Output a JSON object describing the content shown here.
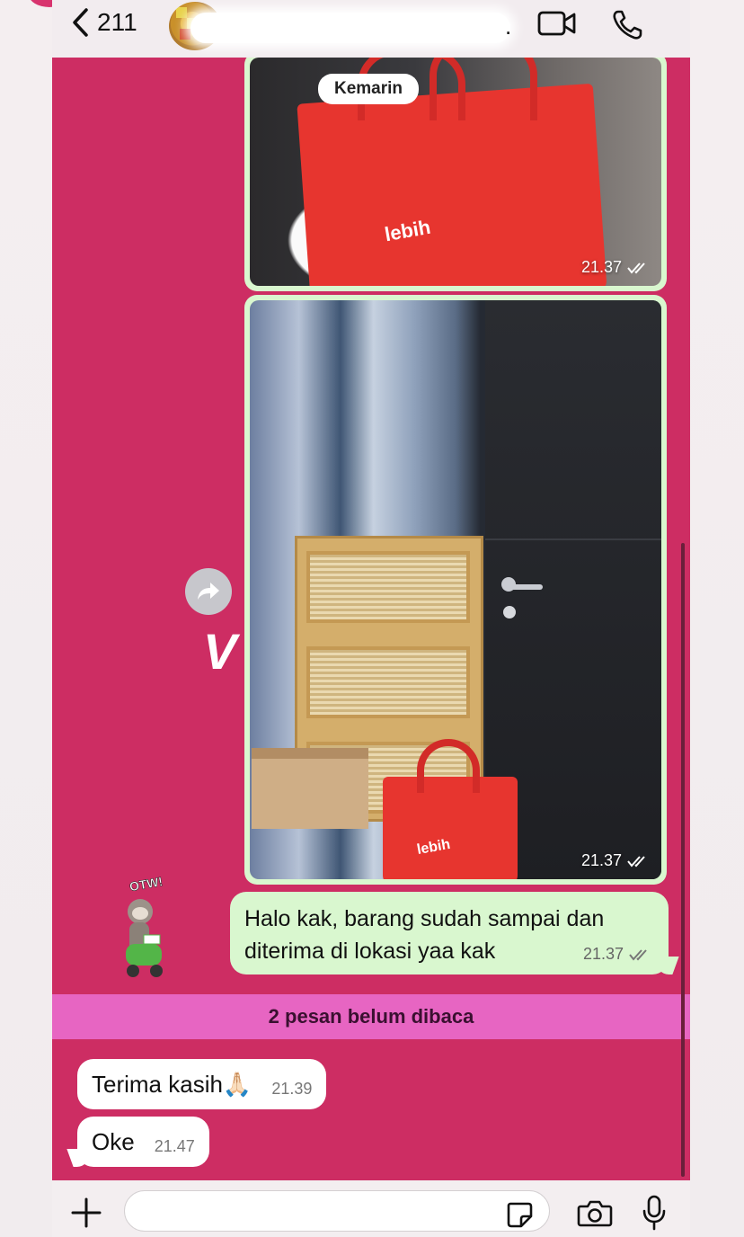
{
  "header": {
    "back_count": "211",
    "name_suffix": "."
  },
  "chat": {
    "date_divider": "Kemarin",
    "images": [
      {
        "time": "21.37",
        "status": "read"
      },
      {
        "time": "21.37",
        "status": "read"
      }
    ],
    "side_mark": "V",
    "sticker_text": "OTW!",
    "outgoing_message": {
      "text": "Halo kak, barang sudah sampai dan diterima di lokasi yaa kak",
      "time": "21.37",
      "status": "read"
    },
    "unread_banner": "2 pesan belum dibaca",
    "incoming_messages": [
      {
        "text": "Terima kasih🙏🏻",
        "time": "21.39"
      },
      {
        "text": "Oke",
        "time": "21.47"
      }
    ]
  },
  "input": {
    "placeholder": ""
  },
  "colors": {
    "chat_background": "#cd2d63",
    "outgoing_bubble": "#d9f7cf",
    "incoming_bubble": "#ffffff",
    "unread_banner": "#e765c2"
  }
}
